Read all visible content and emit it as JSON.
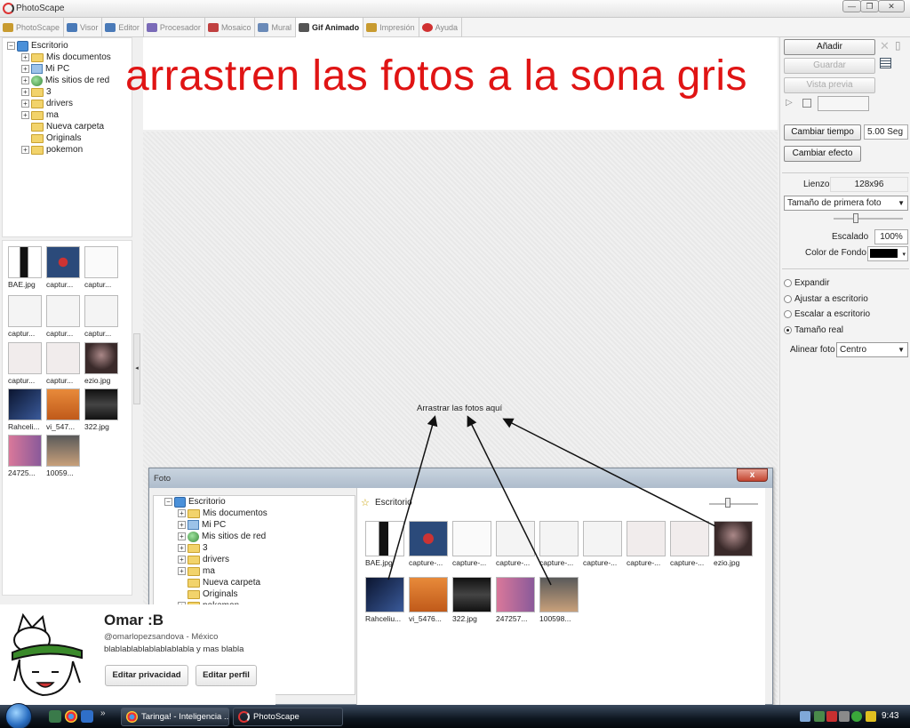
{
  "window": {
    "title": "PhotoScape",
    "buttons": [
      "—",
      "❐",
      "✕"
    ]
  },
  "menu": {
    "tabs": [
      {
        "label": "PhotoScape",
        "color": "#c89b30"
      },
      {
        "label": "Visor",
        "color": "#4a7ab8"
      },
      {
        "label": "Editor",
        "color": "#4a7ab8"
      },
      {
        "label": "Procesador",
        "color": "#7a6ab8"
      },
      {
        "label": "Mosaico",
        "color": "#c04040"
      },
      {
        "label": "Mural",
        "color": "#6a8ab8"
      },
      {
        "label": "Gif Animado",
        "color": "#555555"
      },
      {
        "label": "Impresión",
        "color": "#c89b30"
      },
      {
        "label": "Ayuda",
        "color": "#d03030"
      }
    ],
    "active": "Gif Animado"
  },
  "left_tree": {
    "root": "Escritorio",
    "items": [
      "Mis documentos",
      "Mi PC",
      "Mis sitios de red",
      "3",
      "drivers",
      "ma",
      "Nueva carpeta",
      "Originals",
      "pokemon"
    ]
  },
  "left_thumbs": [
    "BAE.jpg",
    "captur...",
    "captur...",
    "captur...",
    "captur...",
    "captur...",
    "captur...",
    "captur...",
    "ezio.jpg",
    "Rahceli...",
    "vi_547...",
    "322.jpg",
    "24725...",
    "10059..."
  ],
  "canvas": {
    "headline": "arrastren las fotos a la sona gris",
    "drop_hint": "Arrastrar las fotos aquí"
  },
  "right_panel": {
    "add": "Añadir",
    "save": "Guardar",
    "preview": "Vista previa",
    "change_time": "Cambiar tiempo",
    "time_value": "5.00 Seg",
    "change_effect": "Cambiar efecto",
    "canvas_label": "Lienzo",
    "canvas_size": "128x96",
    "size_select": "Tamaño de primera foto",
    "scale_label": "Escalado",
    "scale_value": "100%",
    "bg_label": "Color de Fondo",
    "bg_color": "#000000",
    "options": [
      "Expandir",
      "Ajustar a escritorio",
      "Escalar a escritorio",
      "Tamaño real"
    ],
    "selected_option": "Tamaño real",
    "align_label": "Alinear foto",
    "align_value": "Centro"
  },
  "dialog": {
    "title": "Foto",
    "close": "x",
    "path": "Escritorio",
    "tree_root": "Escritorio",
    "tree_items": [
      "Mis documentos",
      "Mi PC",
      "Mis sitios de red",
      "3",
      "drivers",
      "ma",
      "Nueva carpeta",
      "Originals",
      "pokemon"
    ],
    "thumbs": [
      "BAE.jpg",
      "capture-...",
      "capture-...",
      "capture-...",
      "capture-...",
      "capture-...",
      "capture-...",
      "capture-...",
      "ezio.jpg",
      "Rahceliu...",
      "vi_5476...",
      "322.jpg",
      "247257...",
      "100598..."
    ]
  },
  "profile": {
    "name": "Omar :B",
    "handle": "@omarlopezsandova - México",
    "bio": "blablablablablablablabla y mas blabla",
    "btn_privacy": "Editar privacidad",
    "btn_profile": "Editar perfil"
  },
  "taskbar": {
    "tasks": [
      "Taringa! - Inteligencia ...",
      "PhotoScape"
    ],
    "clock": "9:43"
  }
}
